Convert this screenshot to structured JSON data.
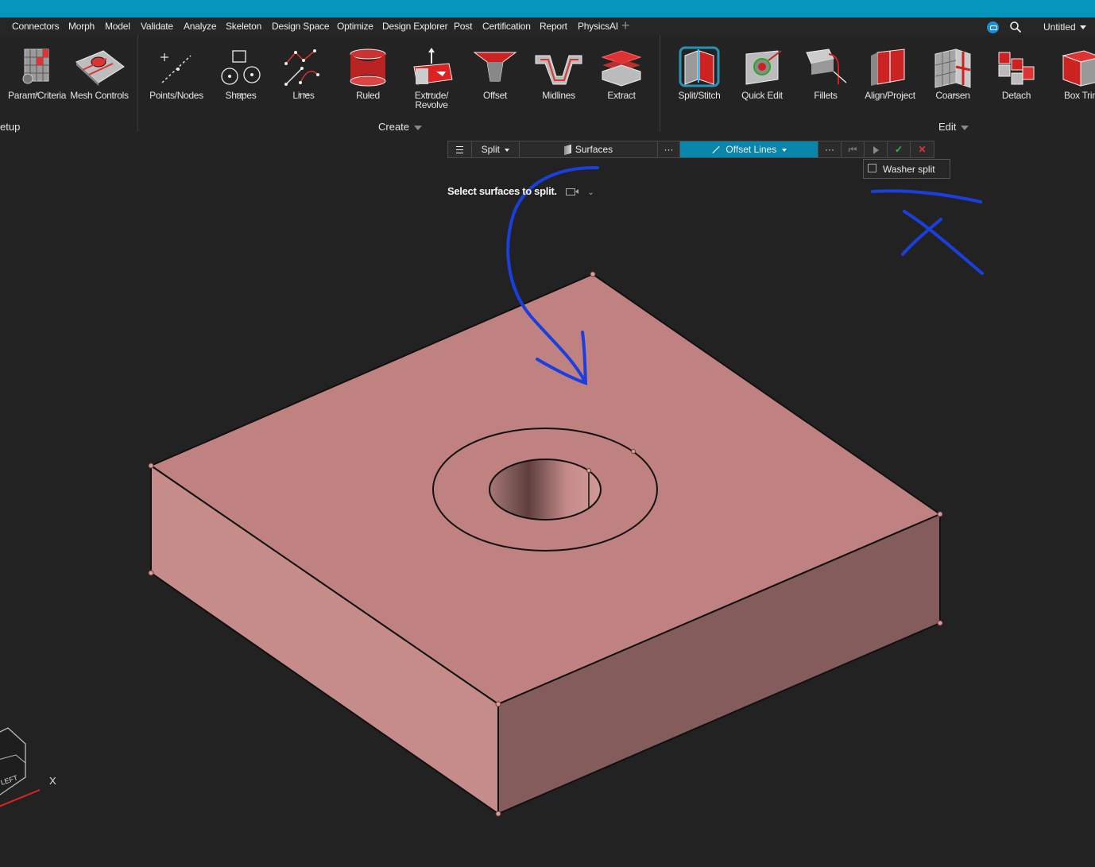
{
  "menu": {
    "items": [
      "Connectors",
      "Morph",
      "Model",
      "Validate",
      "Analyze",
      "Skeleton",
      "Design Space",
      "Optimize",
      "Design Explorer",
      "Post",
      "Certification",
      "Report",
      "PhysicsAI"
    ],
    "add": "+",
    "document": "Untitled"
  },
  "ribbon": {
    "tools": [
      {
        "label": "Param/Criteria",
        "icon": "param-criteria-icon"
      },
      {
        "label": "Mesh Controls",
        "icon": "mesh-controls-icon"
      },
      {
        "label": "Points/Nodes",
        "icon": "points-nodes-icon"
      },
      {
        "label": "Shapes",
        "icon": "shapes-icon"
      },
      {
        "label": "Lines",
        "icon": "lines-icon"
      },
      {
        "label": "Ruled",
        "icon": "ruled-icon"
      },
      {
        "label": "Extrude/",
        "label2": "Revolve",
        "icon": "extrude-revolve-icon"
      },
      {
        "label": "Offset",
        "icon": "offset-icon"
      },
      {
        "label": "Midlines",
        "icon": "midlines-icon"
      },
      {
        "label": "Extract",
        "icon": "extract-icon"
      },
      {
        "label": "Split/Stitch",
        "icon": "split-stitch-icon"
      },
      {
        "label": "Quick Edit",
        "icon": "quick-edit-icon"
      },
      {
        "label": "Fillets",
        "icon": "fillets-icon"
      },
      {
        "label": "Align/Project",
        "icon": "align-project-icon"
      },
      {
        "label": "Coarsen",
        "icon": "coarsen-icon"
      },
      {
        "label": "Detach",
        "icon": "detach-icon"
      },
      {
        "label": "Box Trim",
        "icon": "box-trim-icon"
      }
    ],
    "groups": {
      "setup": "etup",
      "create": "Create",
      "edit": "Edit"
    }
  },
  "guide_bar": {
    "split": "Split",
    "surfaces": "Surfaces",
    "offset_lines": "Offset Lines",
    "more": "···"
  },
  "options": {
    "washer_split": "Washer split",
    "washer_split_checked": false
  },
  "prompt": "Select surfaces to split.",
  "view_cube": {
    "face": "LEFT",
    "axis": "X"
  },
  "colors": {
    "accent": "#0696bb",
    "active": "#0a86ad",
    "part_top": "#c08280",
    "part_front": "#c68c89",
    "part_right": "#845c5b",
    "annotation": "#1a3fe0"
  }
}
